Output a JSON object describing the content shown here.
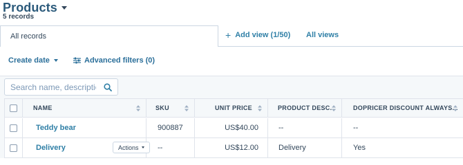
{
  "header": {
    "title": "Products",
    "record_count": "5 records"
  },
  "views": {
    "active_tab": "All records",
    "add_view_label": "Add view (1/50)",
    "all_views_label": "All views"
  },
  "filters": {
    "create_date_label": "Create date",
    "advanced_filters_label": "Advanced filters (0)"
  },
  "search": {
    "placeholder": "Search name, description",
    "value": ""
  },
  "table": {
    "columns": [
      "NAME",
      "SKU",
      "UNIT PRICE",
      "PRODUCT DESC...",
      "DOPRICER DISCOUNT ALWAYS..."
    ],
    "rows": [
      {
        "name": "Teddy bear",
        "sku": "900887",
        "unit_price": "US$40.00",
        "description": "--",
        "dopricer_discount": "--"
      },
      {
        "name": "Delivery",
        "sku": "--",
        "unit_price": "US$12.00",
        "description": "Delivery",
        "dopricer_discount": "Yes",
        "row_action_label": "Actions"
      }
    ]
  },
  "colors": {
    "link": "#2f7fa6",
    "title": "#2b5a7b",
    "text": "#33475b",
    "border": "#cbd6e2",
    "table_header_bg": "#f5f8fa"
  }
}
